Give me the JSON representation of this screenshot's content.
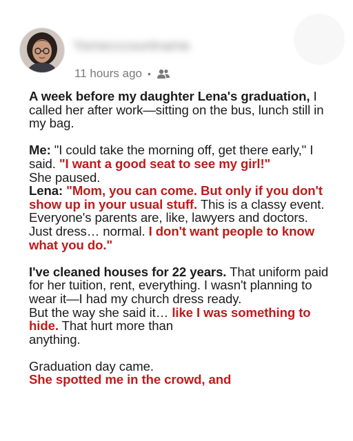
{
  "post": {
    "author": {
      "name": "Yomecccountname",
      "avatar_icon": "avatar-photo"
    },
    "meta": {
      "time": "11 hours ago",
      "separator": "•",
      "audience_icon": "friends-icon"
    },
    "colors": {
      "accent": "#bf1b1b",
      "text": "#1c1c1c",
      "meta": "#7a7a7a"
    },
    "p1": {
      "lead": "A week before my daughter Lena's graduation,",
      "rest": " I called her after work—sitting on the bus, lunch still in my bag."
    },
    "p2": {
      "me_label": "Me:",
      "me_quote": " \"I could take the morning off, get there early,\" I said. ",
      "me_emph": "\"I want a good seat to see my girl!\"",
      "paused": "She paused.",
      "lena_label": "Lena:",
      "lena_emph1": " \"Mom, you can come. But only if you don't show up in your usual stuff.",
      "lena_plain": " This is a classy event. Everyone's parents are, like, lawyers and doctors. Just dress… normal. ",
      "lena_emph2": "I don't want people to know what you do.\""
    },
    "p3": {
      "lead": "I've cleaned houses for 22 years.",
      "rest1": " That uniform paid for her tuition, rent, everything. I wasn't planning to wear it—I had my church dress ready.",
      "but": "But the way she said it… ",
      "emph": "like I was something to hide.",
      "rest2": " That hurt more than",
      "rest3": "anything."
    },
    "p4": {
      "plain": "Graduation day came.",
      "emph": "She spotted me in the crowd, and"
    }
  }
}
